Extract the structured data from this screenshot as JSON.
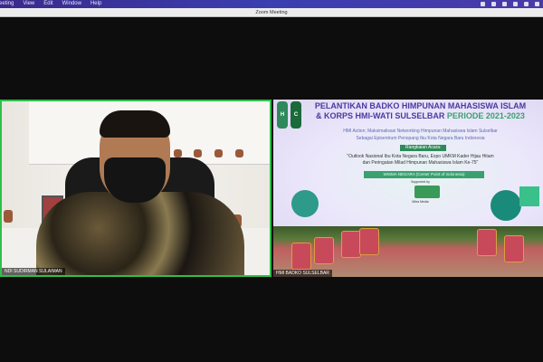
{
  "menubar": {
    "items": [
      "Meeting",
      "View",
      "Edit",
      "Window",
      "Help"
    ]
  },
  "window": {
    "title": "Zoom Meeting"
  },
  "participants": [
    {
      "name": "NDI SUDIRMAN SULAIMAN",
      "active_speaker": true
    },
    {
      "name": "HMI BADKO SULSELBAR",
      "active_speaker": false
    }
  ],
  "banner": {
    "title_line1": "PELANTIKAN BADKO HIMPUNAN MAHASISWA ISLAM",
    "title_line2a": "& KORPS HMI-WATI SULSELBAR ",
    "title_line2b": "PERIODE 2021-2023",
    "theme_line1": "HMI Action; Maksimalisasi Networking Himpunan Mahasiswa Islam Sulselbar",
    "theme_line2": "Sebagai Episentrum Penopang Ibu Kota Negara Baru Indonesia",
    "agenda_label": "Rangkaian Acara:",
    "agenda_line1": "\"Outlook Nasional Ibu Kota Negara Baru, Expo UMKM Kader Hijau Hitam",
    "agenda_line2": "dan Peringatan Milad Himpunan Mahasiswa Islam Ke-75\"",
    "venue": "WISMA NEGARA (Center Point of Indonesia)",
    "supported_by": "Supported by",
    "media": "Mitra Media",
    "logo_text": "HMI"
  },
  "colors": {
    "active_border": "#2fbf4a",
    "banner_title": "#4a3aa0",
    "banner_accent": "#3aa070"
  }
}
